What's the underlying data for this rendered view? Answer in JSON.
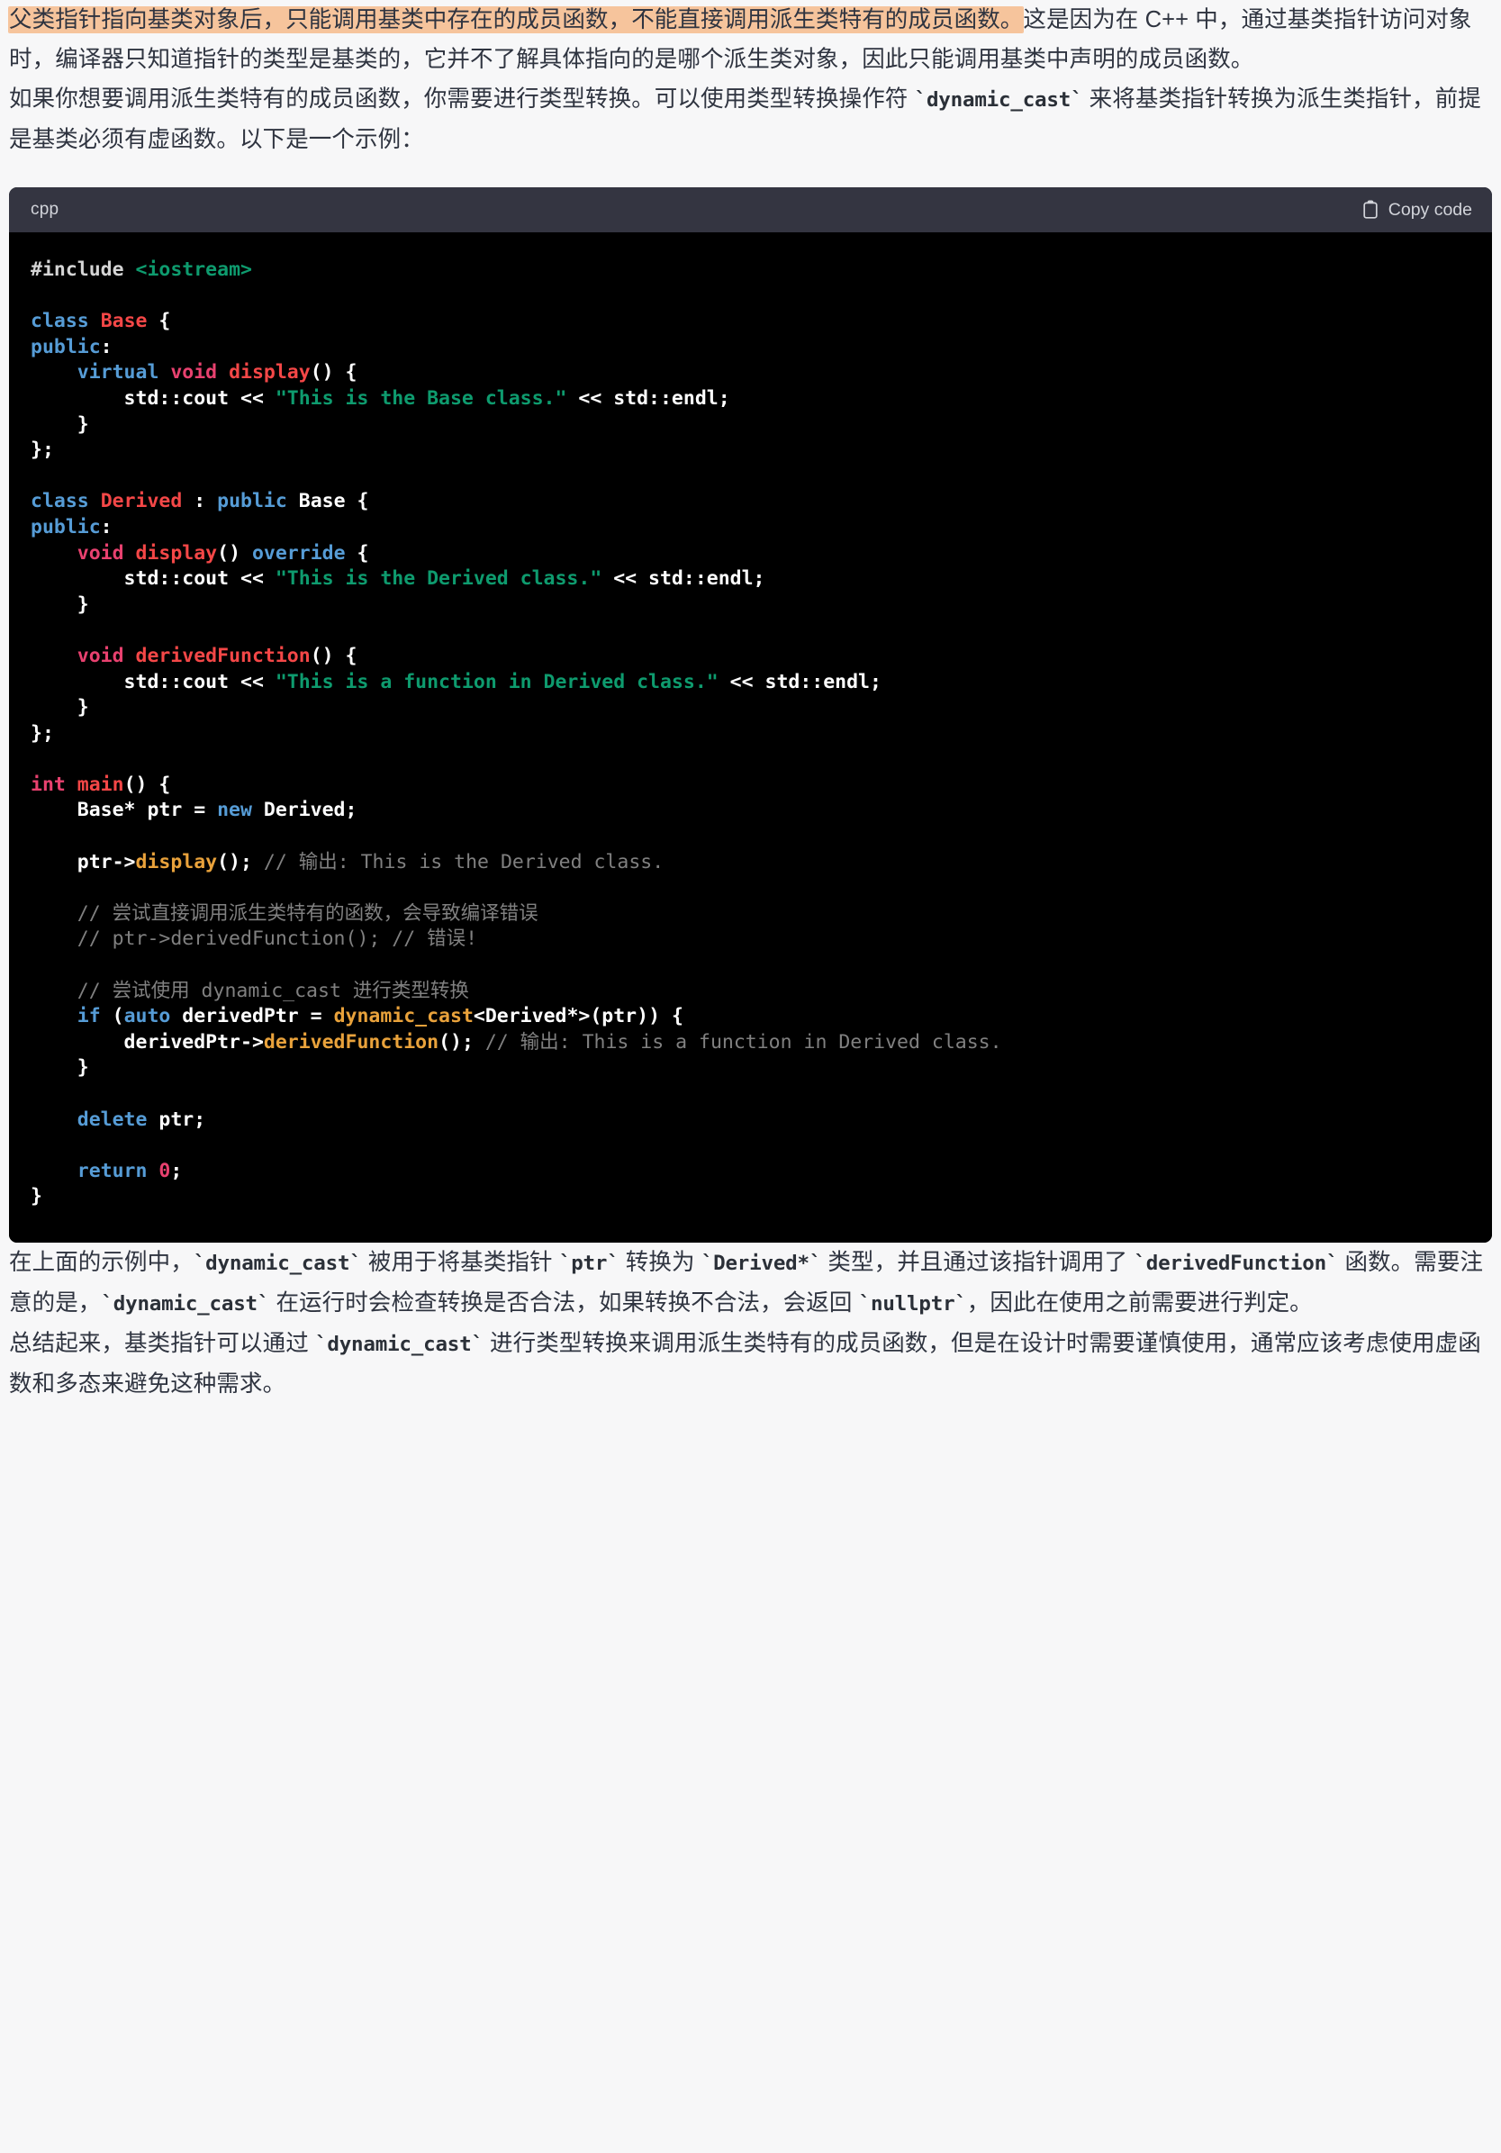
{
  "paragraphs": {
    "p1_highlight": "父类指针指向基类对象后，只能调用基类中存在的成员函数，不能直接调用派生类特有的成员函数。",
    "p1_rest": "这是因为在 C++ 中，通过基类指针访问对象时，编译器只知道指针的类型是基类的，它并不了解具体指向的是哪个派生类对象，因此只能调用基类中声明的成员函数。",
    "p2_a": "如果你想要调用派生类特有的成员函数，你需要进行类型转换。可以使用类型转换操作符 ",
    "p2_code": "`dynamic_cast`",
    "p2_b": " 来将基类指针转换为派生类指针，前提是基类必须有虚函数。以下是一个示例：",
    "p3_a": "在上面的示例中，",
    "p3_code1": "`dynamic_cast`",
    "p3_b": " 被用于将基类指针 ",
    "p3_code2": "`ptr`",
    "p3_c": " 转换为 ",
    "p3_code3": "`Derived*`",
    "p3_d": " 类型，并且通过该指针调用了 ",
    "p3_code4": "`derivedFunction`",
    "p3_e": " 函数。需要注意的是，",
    "p3_code5": "`dynamic_cast`",
    "p3_f": " 在运行时会检查转换是否合法，如果转换不合法，会返回 ",
    "p3_code6": "`nullptr`",
    "p3_g": "，因此在使用之前需要进行判定。",
    "p4_a": "总结起来，基类指针可以通过 ",
    "p4_code": "`dynamic_cast`",
    "p4_b": " 进行类型转换来调用派生类特有的成员函数，但是在设计时需要谨慎使用，通常应该考虑使用虚函数和多态来避免这种需求。"
  },
  "code_block": {
    "language": "cpp",
    "copy_label": "Copy code",
    "copy_icon": "clipboard-icon",
    "code_text": "#include <iostream>\n\nclass Base {\npublic:\n    virtual void display() {\n        std::cout << \"This is the Base class.\" << std::endl;\n    }\n};\n\nclass Derived : public Base {\npublic:\n    void display() override {\n        std::cout << \"This is the Derived class.\" << std::endl;\n    }\n\n    void derivedFunction() {\n        std::cout << \"This is a function in Derived class.\" << std::endl;\n    }\n};\n\nint main() {\n    Base* ptr = new Derived;\n\n    ptr->display(); // 输出: This is the Derived class.\n\n    // 尝试直接调用派生类特有的函数，会导致编译错误\n    // ptr->derivedFunction(); // 错误!\n\n    // 尝试使用 dynamic_cast 进行类型转换\n    if (auto derivedPtr = dynamic_cast<Derived*>(ptr)) {\n        derivedPtr->derivedFunction(); // 输出: This is a function in Derived class.\n    }\n\n    delete ptr;\n\n    return 0;\n}"
  },
  "colors": {
    "page_background": "#F7F7F8",
    "highlight": "#F6C49C",
    "code_header_background": "#343541",
    "code_background": "#000000",
    "text": "#2F3440",
    "keyword": "#569CD6",
    "type": "#F44747",
    "string": "#0E9B6E",
    "magenta": "#E8416F",
    "function": "#E9A23B",
    "comment": "#808080"
  }
}
